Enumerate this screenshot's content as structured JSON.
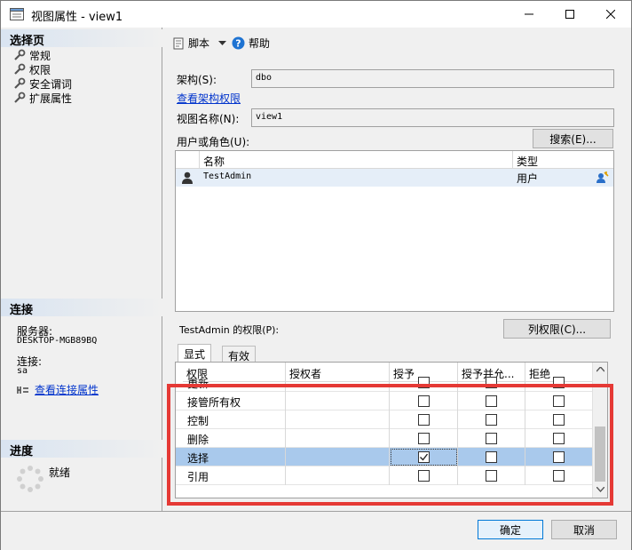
{
  "window": {
    "title": "视图属性 - view1",
    "controls": [
      "minimize",
      "maximize",
      "close"
    ]
  },
  "left": {
    "select_page_header": "选择页",
    "pages": [
      {
        "label": "常规",
        "icon": "wrench-icon"
      },
      {
        "label": "权限",
        "icon": "wrench-icon"
      },
      {
        "label": "安全谓词",
        "icon": "wrench-icon"
      },
      {
        "label": "扩展属性",
        "icon": "wrench-icon"
      }
    ],
    "connection_header": "连接",
    "server_label": "服务器:",
    "server_value": "DESKTOP-MGB89BQ",
    "connect_label": "连接:",
    "connect_value": "sa",
    "view_connection_link": "查看连接属性",
    "progress_header": "进度",
    "progress_status": "就绪"
  },
  "toolbar": {
    "script_label": "脚本",
    "help_label": "帮助"
  },
  "form": {
    "schema_label": "架构(S):",
    "schema_value": "dbo",
    "view_schema_perm_link": "查看架构权限",
    "view_name_label": "视图名称(N):",
    "view_name_value": "view1",
    "users_roles_label": "用户或角色(U):",
    "search_button": "搜索(E)..."
  },
  "users_grid": {
    "columns": [
      "名称",
      "类型"
    ],
    "rows": [
      {
        "name": "TestAdmin",
        "type": "用户"
      }
    ]
  },
  "permissions": {
    "label": "TestAdmin 的权限(P):",
    "column_perm_button": "列权限(C)...",
    "tabs": [
      "显式",
      "有效"
    ],
    "columns": [
      "权限",
      "授权者",
      "授予",
      "授予并允...",
      "拒绝"
    ],
    "rows": [
      {
        "name": "更新",
        "grantor": "",
        "grant": false,
        "with_grant": false,
        "deny": false,
        "partial": true
      },
      {
        "name": "接管所有权",
        "grantor": "",
        "grant": false,
        "with_grant": false,
        "deny": false
      },
      {
        "name": "控制",
        "grantor": "",
        "grant": false,
        "with_grant": false,
        "deny": false
      },
      {
        "name": "删除",
        "grantor": "",
        "grant": false,
        "with_grant": false,
        "deny": false
      },
      {
        "name": "选择",
        "grantor": "",
        "grant": true,
        "with_grant": false,
        "deny": false,
        "selected": true
      },
      {
        "name": "引用",
        "grantor": "",
        "grant": false,
        "with_grant": false,
        "deny": false
      }
    ]
  },
  "buttons": {
    "ok": "确定",
    "cancel": "取消"
  },
  "colors": {
    "highlight_frame": "#e53935",
    "selected_row": "#a9c9ec",
    "link": "#0033cc"
  }
}
